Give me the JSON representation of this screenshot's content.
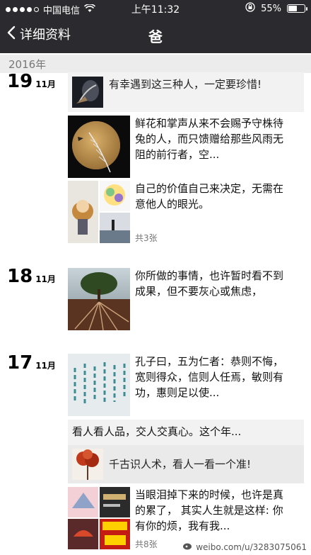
{
  "status_bar": {
    "carrier": "中国电信",
    "time": "上午11:32",
    "battery": "55%",
    "battery_level": 0.55,
    "signal_bars": 4
  },
  "nav": {
    "back_label": "详细资料",
    "title": "爸"
  },
  "year": "2016年",
  "days": [
    {
      "day": "19",
      "month": "11月",
      "shared": {
        "text": "有幸遇到这三种人，一定要珍惜!"
      },
      "posts": [
        {
          "text": "鲜花和掌声从来不会赐予守株待兔的人，而只馈赠给那些风雨无阻的前行者，空..."
        },
        {
          "text": "自己的价值自己来决定，无需在意他人的眼光。",
          "count": "共3张"
        }
      ]
    },
    {
      "day": "18",
      "month": "11月",
      "posts": [
        {
          "text": "你所做的事情，也许暂时看不到成果，但不要灰心或焦虑，"
        }
      ]
    },
    {
      "day": "17",
      "month": "11月",
      "posts": [
        {
          "text": "孔子曰，五为仁者：恭则不悔，宽则得众，信则人任焉，敏则有功，惠则足以使..."
        },
        {
          "text": "当眼泪掉下来的时候，也许是真的累了， 其实人生就是这样: 你有你的烦，我有我...",
          "count": "共8张"
        }
      ],
      "composite": {
        "text": "看人看人品，交人交真心。这个年...",
        "shared_text": "千古识人术，看人一看一个准!"
      }
    }
  ],
  "watermark": "weibo.com/u/3283075061"
}
